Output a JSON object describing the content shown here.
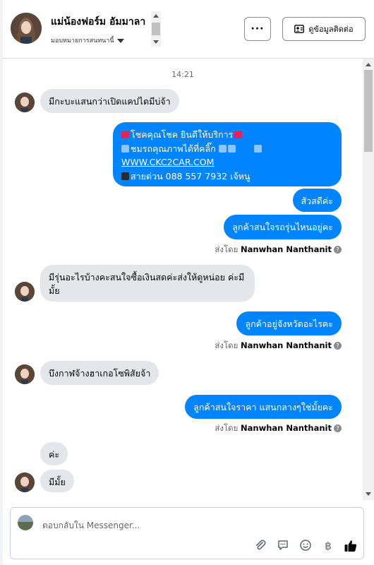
{
  "header": {
    "name": "แม่น้องฟอร์ม อัมมาลา",
    "assign_label": "มอบหมายการสนทนานี้",
    "more_label": "···",
    "contact_label": "ดูข้อมูลติดต่อ"
  },
  "chat": {
    "timestamp": "14:21",
    "sent_by_prefix": "ส่งโดย",
    "sent_by_name": "Nanwhan Nanthanit",
    "messages": {
      "m1": "มีกะบะแสนกว่าเปิดแคปไดมีบ่จ้า",
      "m2_line1": "โชคคุณโชค ยินดีให้บริการ",
      "m2_line2": "ชมรถคุณภาพได้ที่คลิ๊ก",
      "m2_link": "WWW.CKC2CAR.COM",
      "m2_line4": "สายด่วน 088 557 7932 เจ้หนู",
      "m3": "สัวสดีค่ะ",
      "m4": "ลูกค้าสนใจรถรุ่นไหนอยู่คะ",
      "m5": "มีรุ่นอะไรบ้างคะสนใจซื้อเงินสดค่ะส่งให้ดูหน่อย ค่ะมีมั้ย",
      "m6": "ลูกค้าอยู่จังหวัดอะไรคะ",
      "m7": "บึงกาฬจ้างฮาเกอโซพิสัยจ้า",
      "m8": "ลูกค้าสนใจราคา แสนกลางๆใช่มั้ยคะ",
      "m9": "ค่ะ",
      "m10": "มีมั้ย"
    }
  },
  "composer": {
    "placeholder": "ตอบกลับใน Messenger..."
  },
  "icons": [
    "ellipsis-icon",
    "contact-card-icon",
    "attach-icon",
    "reply-icon",
    "emoji-icon",
    "currency-icon",
    "like-icon"
  ],
  "colors": {
    "outgoing": "#0084ff",
    "incoming": "#e4e6eb"
  }
}
